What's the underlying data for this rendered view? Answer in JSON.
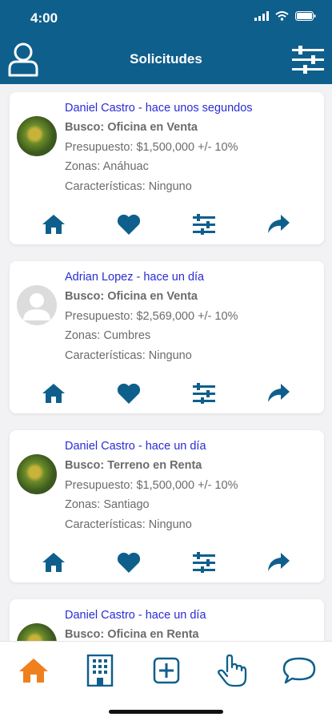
{
  "status_bar": {
    "time": "4:00"
  },
  "header": {
    "title": "Solicitudes"
  },
  "labels": {
    "busco": "Busco:",
    "presupuesto": "Presupuesto:",
    "zonas": "Zonas:",
    "caracteristicas": "Características:"
  },
  "requests": [
    {
      "author_line": "Daniel Castro - hace unos segundos",
      "avatar": "photo",
      "busco": "Oficina en Venta",
      "presupuesto": "$1,500,000 +/- 10%",
      "zonas": "Anáhuac",
      "caracteristicas": "Ninguno"
    },
    {
      "author_line": "Adrian Lopez - hace un día",
      "avatar": "placeholder",
      "busco": "Oficina en Venta",
      "presupuesto": "$2,569,000 +/- 10%",
      "zonas": "Cumbres",
      "caracteristicas": "Ninguno"
    },
    {
      "author_line": "Daniel Castro - hace un día",
      "avatar": "photo",
      "busco": "Terreno en Renta",
      "presupuesto": "$1,500,000 +/- 10%",
      "zonas": "Santiago",
      "caracteristicas": "Ninguno"
    },
    {
      "author_line": "Daniel Castro - hace un día",
      "avatar": "photo",
      "busco": "Oficina en Renta"
    }
  ],
  "card_actions": [
    "home-icon",
    "heart-icon",
    "sliders-icon",
    "share-icon"
  ],
  "tabbar": {
    "items": [
      "home-icon",
      "building-icon",
      "plus-square-icon",
      "hand-pointer-icon",
      "chat-bubble-icon"
    ],
    "active_index": 0
  },
  "colors": {
    "primary": "#0f5f8c",
    "accent": "#f07f1e",
    "link": "#2b2bd6",
    "text_gray": "#6b6b6b"
  }
}
